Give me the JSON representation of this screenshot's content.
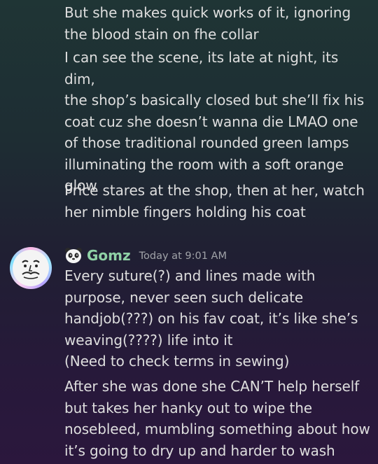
{
  "messages_above": [
    "But she makes quick works of it, ignoring\nthe blood stain on fhe collar",
    "I can see the scene, its late at night, its dim,\nthe shop’s basically closed but she’ll fix his\ncoat cuz she doesn’t wanna die LMAO one\nof those traditional rounded green lamps\nilluminating the room with a soft orange\nglow",
    "Price stares at the shop, then at her, watch\nher nimble fingers holding his coat"
  ],
  "author": {
    "emoji_icon": "panda-icon",
    "username": "Gomz",
    "timestamp": "Today at 9:01 AM",
    "name_color": "#8fd1a6"
  },
  "messages_below": [
    "Every suture(?) and lines made with\npurpose, never seen such delicate\nhandjob(???) on his fav coat, it’s like she’s\nweaving(????) life into it\n(Need to check terms in sewing)",
    "After she was done she CAN’T help herself\nbut takes her hanky out to wipe the\nnosebleed, mumbling something about how\nit’s going to dry up and harder to wash"
  ]
}
